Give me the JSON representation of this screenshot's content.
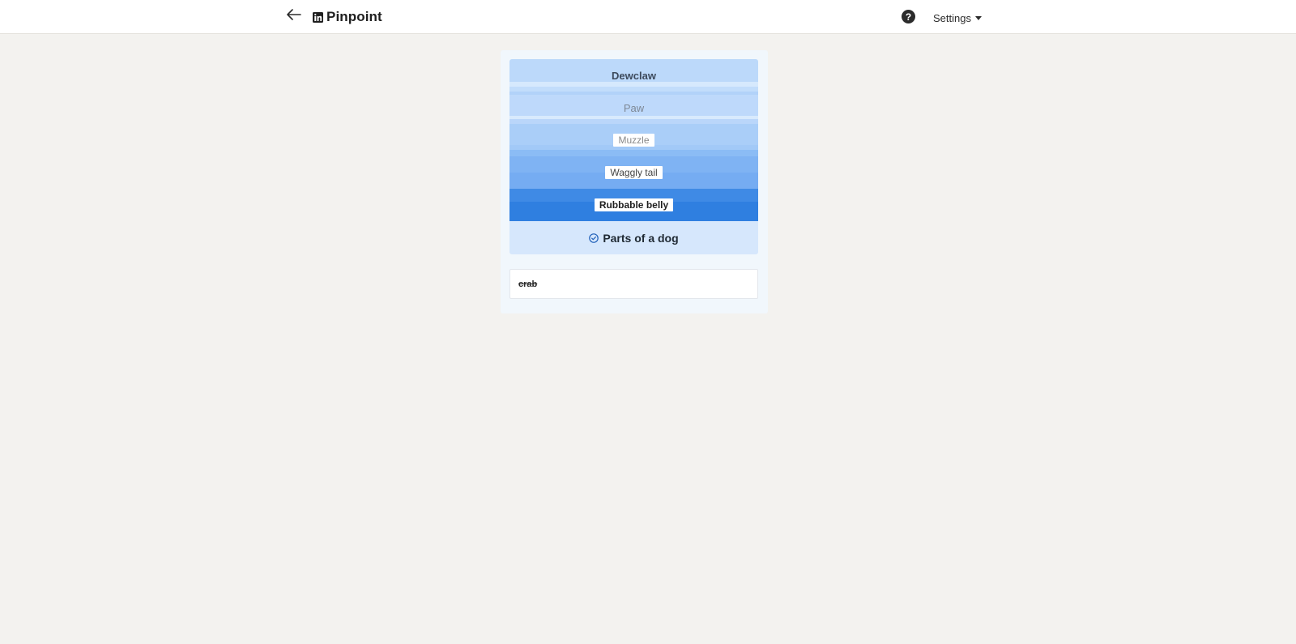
{
  "header": {
    "back_icon": "arrow-left-icon",
    "logo_icon": "linkedin-icon",
    "title": "Pinpoint",
    "help_icon": "question-circle-icon",
    "help_glyph": "?",
    "settings_label": "Settings",
    "settings_caret_icon": "caret-down-icon"
  },
  "game": {
    "clues": [
      {
        "text": "Dewclaw",
        "style": "plain"
      },
      {
        "text": "Paw",
        "style": "faded"
      },
      {
        "text": "Muzzle",
        "style": "chip-light"
      },
      {
        "text": "Waggly tail",
        "style": "chip"
      },
      {
        "text": "Rubbable belly",
        "style": "chip-dark"
      }
    ],
    "answer": {
      "icon": "check-circle-icon",
      "text": "Parts of a dog"
    },
    "guesses": [
      {
        "text": "crab",
        "status": "incorrect"
      }
    ]
  },
  "colors": {
    "page_bg": "#f3f2ef",
    "accent_blue": "#2f7fe0",
    "answer_bg": "#d6e7fc"
  }
}
